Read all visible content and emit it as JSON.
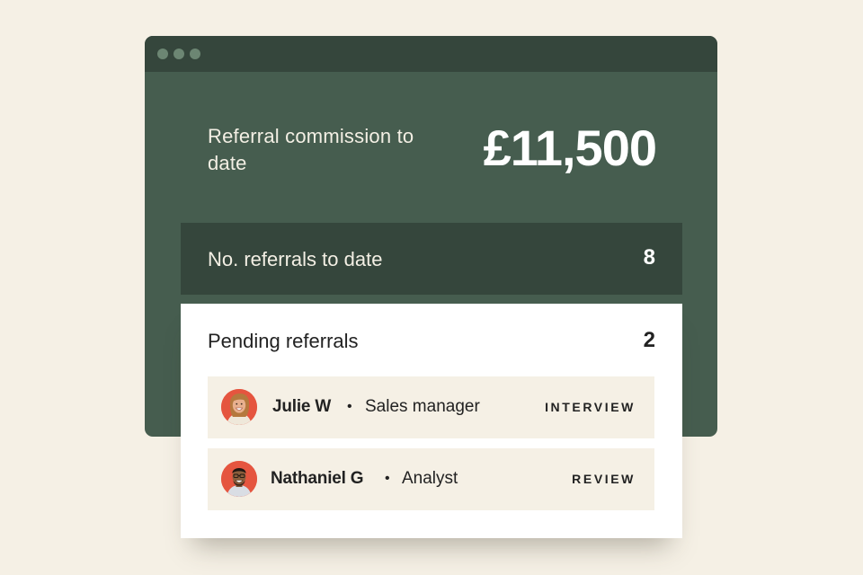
{
  "commission": {
    "label": "Referral commission to date",
    "amount": "£11,500"
  },
  "referrals": {
    "label": "No. referrals to date",
    "count": "8"
  },
  "pending": {
    "title": "Pending referrals",
    "count": "2",
    "items": [
      {
        "name": "Julie W",
        "separator": "•",
        "role": "Sales manager",
        "status": "INTERVIEW",
        "avatar": "avatar-julie"
      },
      {
        "name": "Nathaniel G",
        "separator": "•",
        "role": "Analyst",
        "status": "REVIEW",
        "avatar": "avatar-nathaniel"
      }
    ]
  },
  "theme": {
    "background": "#f5f0e5",
    "window": "#465d4f",
    "dark_panel": "#35463c",
    "avatar_bg": "#e5553f",
    "row_bg": "#f5f0e5"
  }
}
